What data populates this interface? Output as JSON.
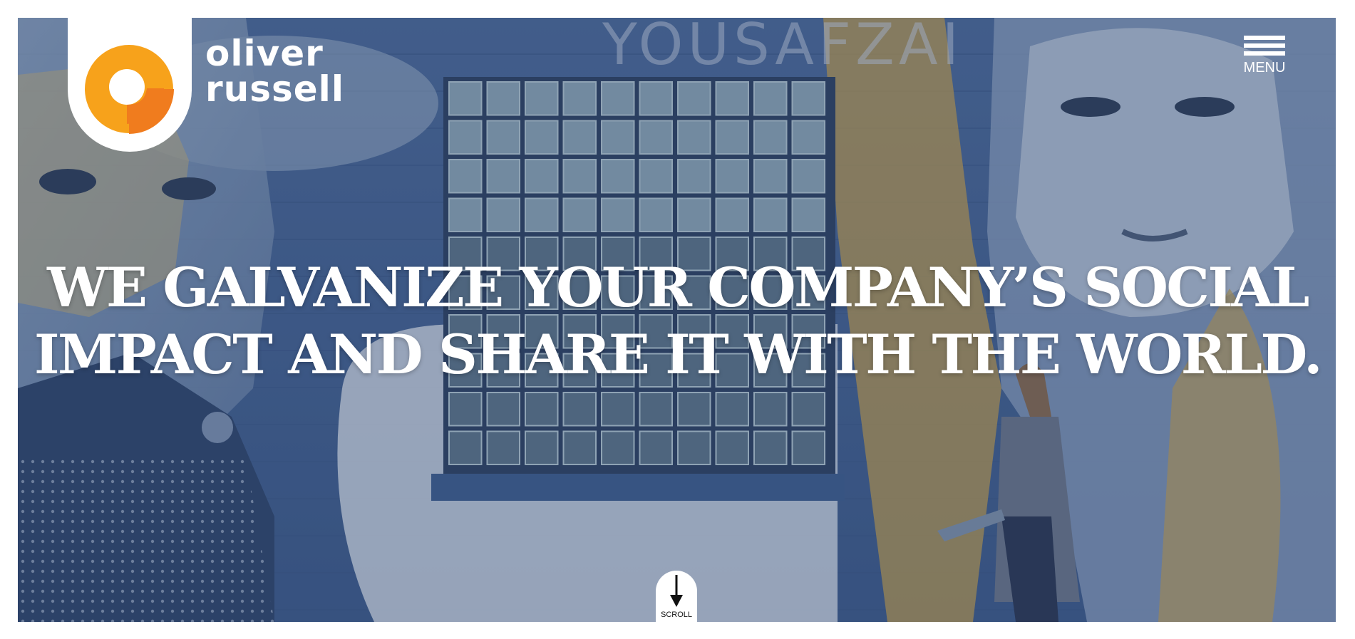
{
  "brand": {
    "name_line1": "oliver",
    "name_line2": "russell",
    "accent_color": "#F7A21B",
    "accent_dark": "#F07C1E"
  },
  "header": {
    "menu_label": "MENU",
    "menu_icon": "hamburger-icon"
  },
  "hero": {
    "background_image_text": "YOUSAFZAI",
    "headline_line1": "WE GALVANIZE YOUR COMPANY’S SOCIAL",
    "headline_line2": "IMPACT AND SHARE IT WITH THE WORLD."
  },
  "scroll": {
    "label": "SCROLL",
    "icon": "arrow-down-icon"
  }
}
